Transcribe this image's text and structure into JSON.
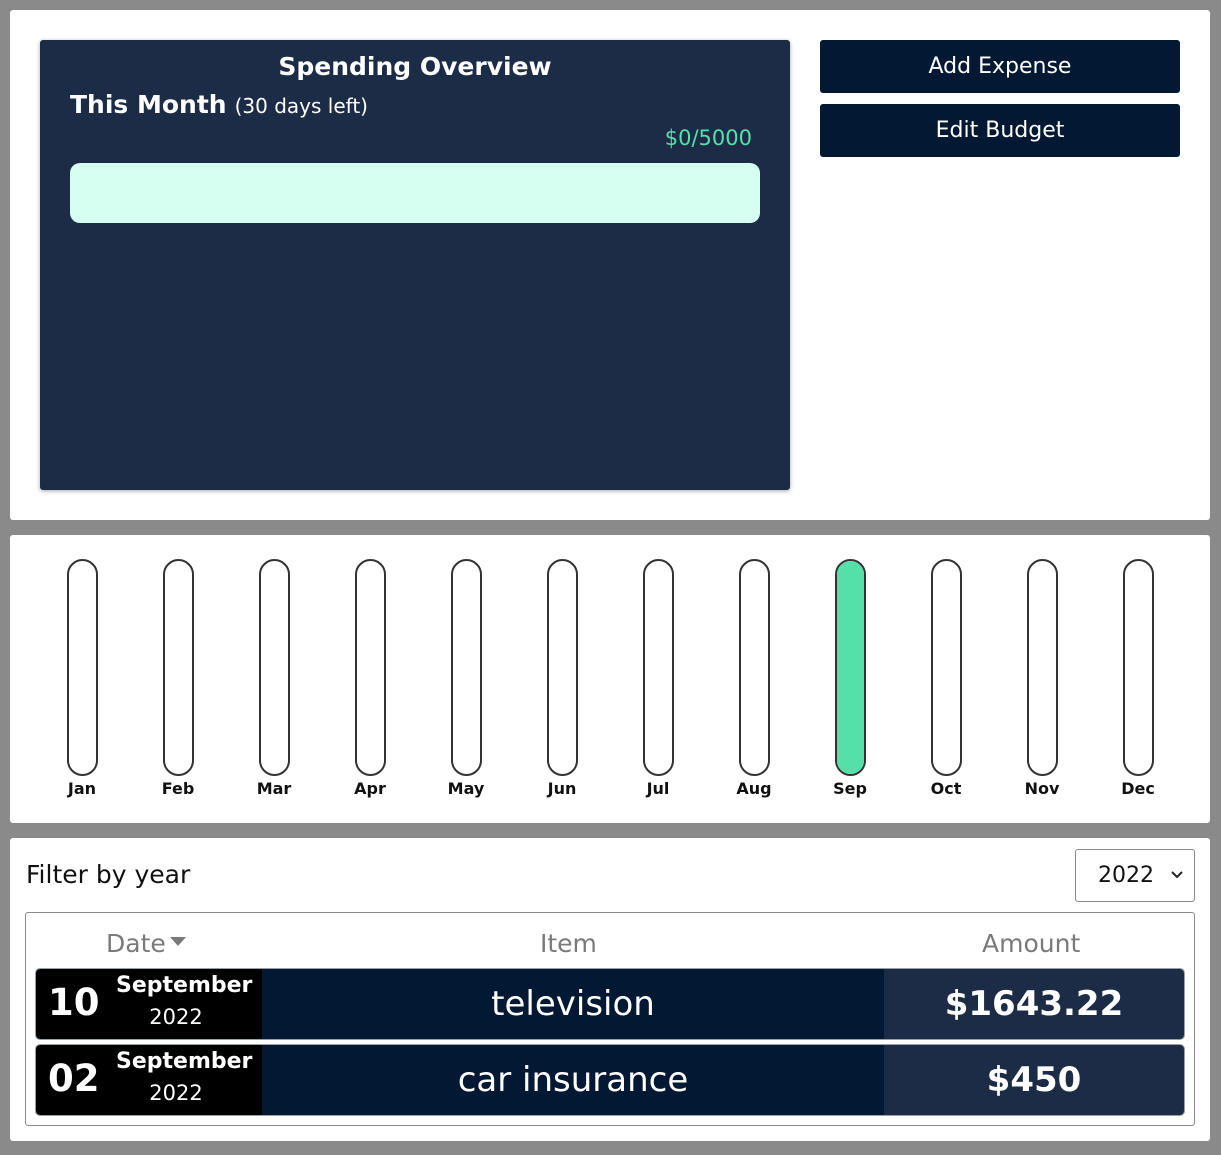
{
  "overview": {
    "title": "Spending Overview",
    "period_label": "This Month",
    "days_left": "(30 days left)",
    "amount_text": "$0/5000",
    "spent_fraction": 0,
    "colors": {
      "card": "#1c2c47",
      "accent": "#55e0aa",
      "bar_bg": "#d6fff1"
    }
  },
  "actions": {
    "add_expense": "Add Expense",
    "edit_budget": "Edit Budget"
  },
  "chart_data": {
    "type": "bar",
    "categories": [
      "Jan",
      "Feb",
      "Mar",
      "Apr",
      "May",
      "Jun",
      "Jul",
      "Aug",
      "Sep",
      "Oct",
      "Nov",
      "Dec"
    ],
    "values": [
      0,
      0,
      0,
      0,
      0,
      0,
      0,
      0,
      1,
      0,
      0,
      0
    ],
    "fill_color": "#55e0aa"
  },
  "filter": {
    "label": "Filter by year",
    "selected_year": "2022"
  },
  "table": {
    "headers": {
      "date": "Date",
      "item": "Item",
      "amount": "Amount"
    },
    "sort_icon": "caret-down-icon",
    "rows": [
      {
        "day": "10",
        "month": "September",
        "year": "2022",
        "item": "television",
        "amount": "$1643.22"
      },
      {
        "day": "02",
        "month": "September",
        "year": "2022",
        "item": "car insurance",
        "amount": "$450"
      }
    ]
  }
}
